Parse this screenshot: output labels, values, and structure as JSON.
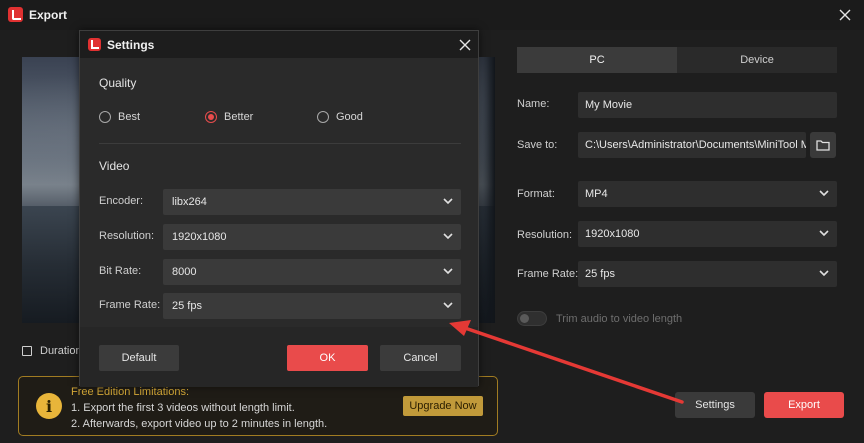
{
  "window": {
    "title": "Export",
    "close_icon": "close-icon",
    "logo_icon": "minitool-logo-icon"
  },
  "preview": {
    "duration_label": "Duration:",
    "duration_icon": "film-icon"
  },
  "tabs": [
    {
      "label": "PC",
      "active": true
    },
    {
      "label": "Device",
      "active": false
    }
  ],
  "form": {
    "name": {
      "label": "Name:",
      "value": "My Movie"
    },
    "save_to": {
      "label": "Save to:",
      "value": "C:\\Users\\Administrator\\Documents\\MiniTool MovieMaker\\output",
      "browse_icon": "folder-icon"
    },
    "format": {
      "label": "Format:",
      "value": "MP4"
    },
    "resolution": {
      "label": "Resolution:",
      "value": "1920x1080"
    },
    "frame_rate": {
      "label": "Frame Rate:",
      "value": "25 fps"
    },
    "trim_audio": {
      "label": "Trim audio to video length",
      "enabled": false
    }
  },
  "limitations": {
    "title": "Free Edition Limitations:",
    "line1": "1. Export the first 3 videos without length limit.",
    "line2": "2. Afterwards, export video up to 2 minutes in length.",
    "upgrade_label": "Upgrade Now",
    "icon": "info-icon"
  },
  "buttons": {
    "settings": "Settings",
    "export": "Export"
  },
  "settings_dialog": {
    "title": "Settings",
    "quality": {
      "title": "Quality",
      "options": [
        {
          "label": "Best",
          "selected": false
        },
        {
          "label": "Better",
          "selected": true
        },
        {
          "label": "Good",
          "selected": false
        }
      ]
    },
    "video": {
      "title": "Video",
      "encoder": {
        "label": "Encoder:",
        "value": "libx264"
      },
      "resolution": {
        "label": "Resolution:",
        "value": "1920x1080"
      },
      "bit_rate": {
        "label": "Bit Rate:",
        "value": "8000"
      },
      "frame_rate": {
        "label": "Frame Rate:",
        "value": "25 fps"
      }
    },
    "buttons": {
      "default": "Default",
      "ok": "OK",
      "cancel": "Cancel"
    }
  },
  "colors": {
    "accent": "#e94b4b",
    "annotation_arrow": "#e53935",
    "warning": "#d3a737"
  }
}
